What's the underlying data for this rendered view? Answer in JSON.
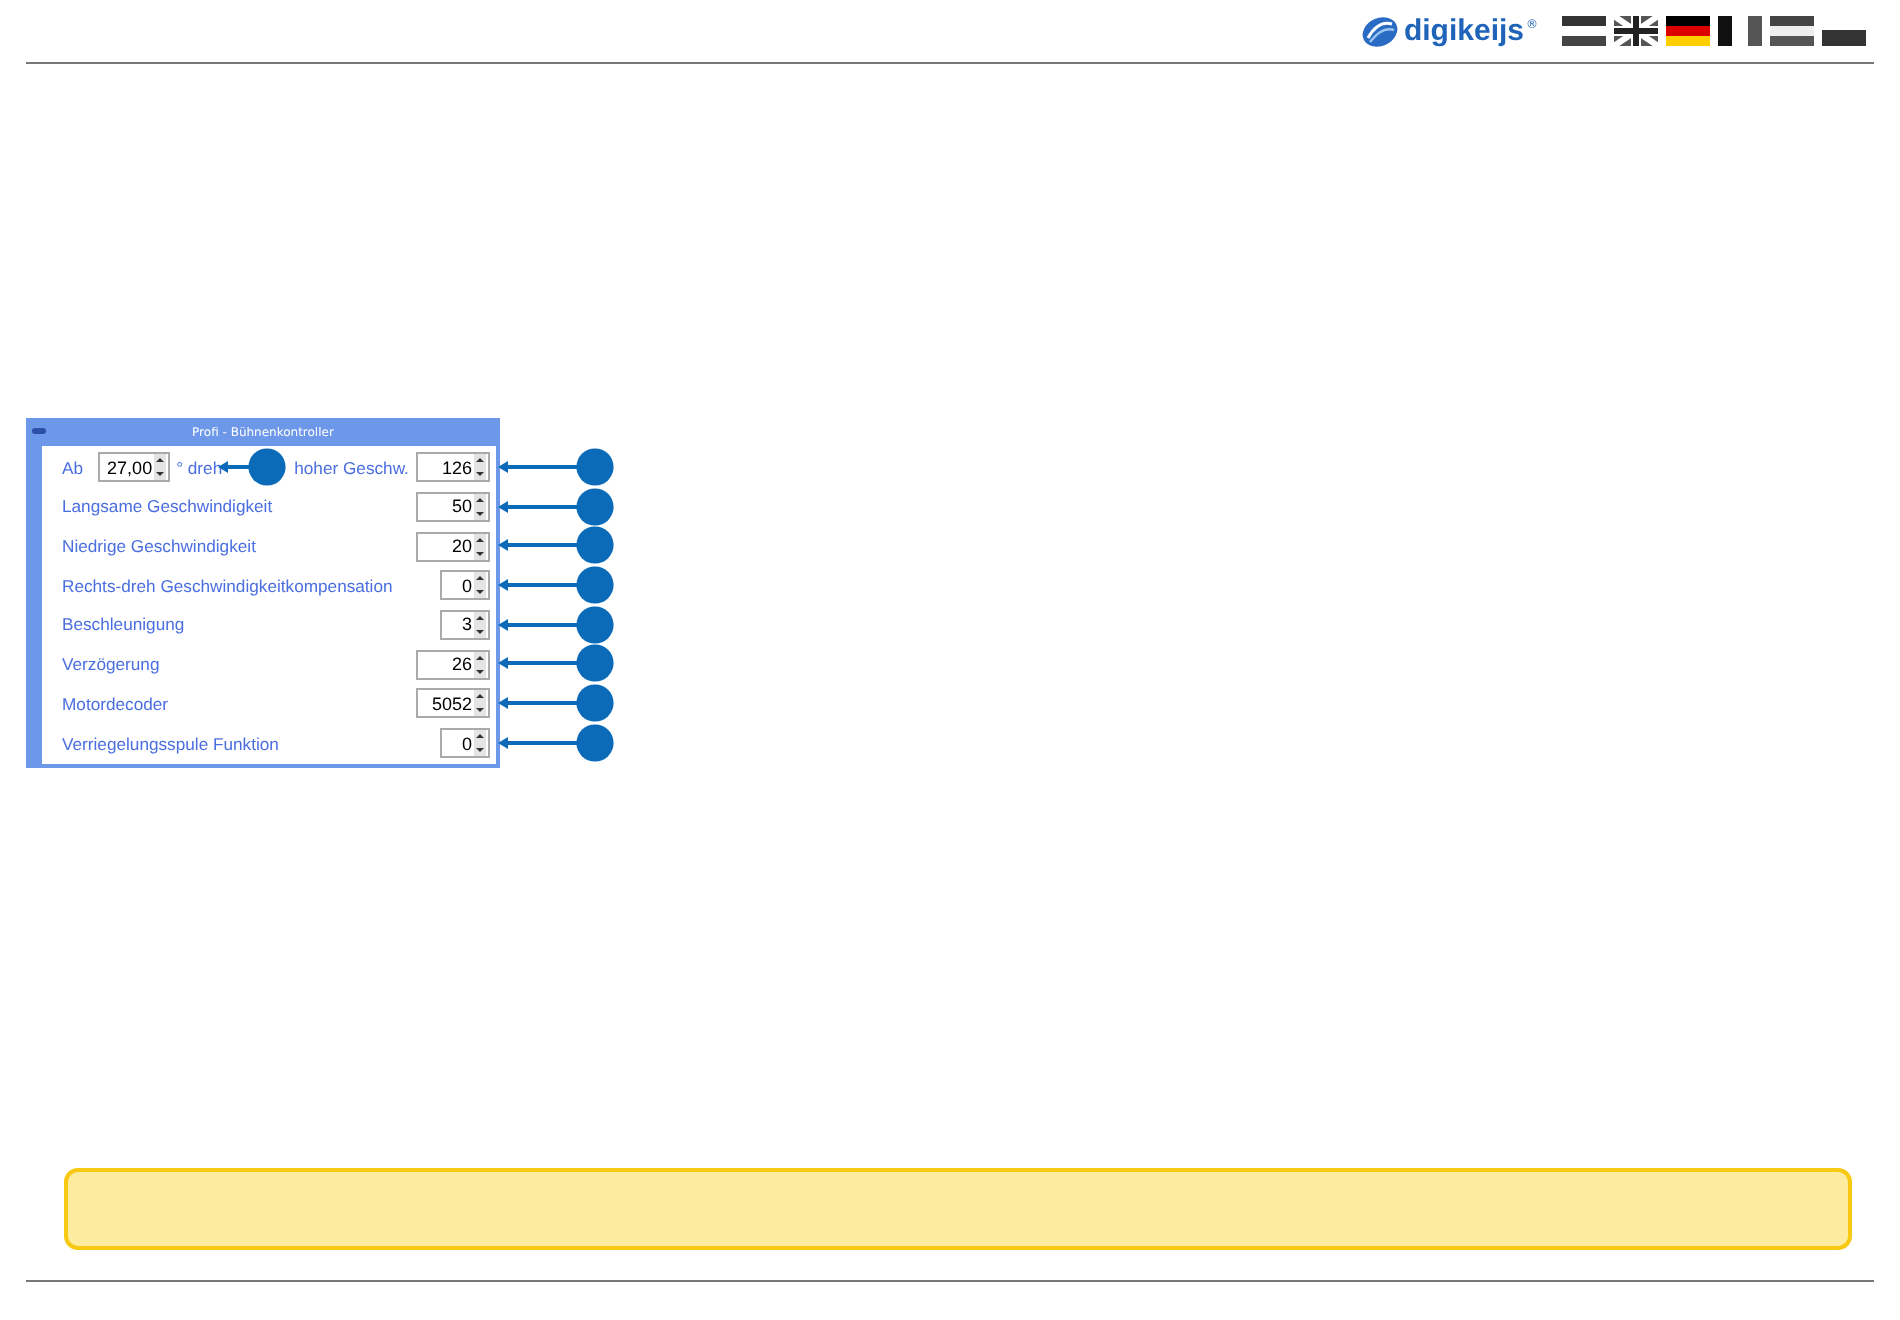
{
  "header": {
    "logo": {
      "text": "digikeijs",
      "mark": "®"
    }
  },
  "panel": {
    "title": "Profi - Bühnenkontroller",
    "rows": [
      {
        "kind": "range",
        "label": "Ab",
        "value": "27,00",
        "unit": "° dreh",
        "label_2": "hoher Geschw.",
        "value_2": "126"
      },
      {
        "kind": "single",
        "label": "Langsame Geschwindigkeit",
        "value": "50"
      },
      {
        "kind": "single",
        "label": "Niedrige Geschwindigkeit",
        "value": "20"
      },
      {
        "kind": "single",
        "label": "Rechts-dreh Geschwindigkeitkompensation",
        "value": "0"
      },
      {
        "kind": "single",
        "label": "Beschleunigung",
        "value": "3"
      },
      {
        "kind": "single",
        "label": "Verzögerung",
        "value": "26"
      },
      {
        "kind": "single",
        "label": "Motordecoder",
        "value": "5052"
      },
      {
        "kind": "single",
        "label": "Verriegelungsspule Funktion",
        "value": "0"
      }
    ]
  }
}
